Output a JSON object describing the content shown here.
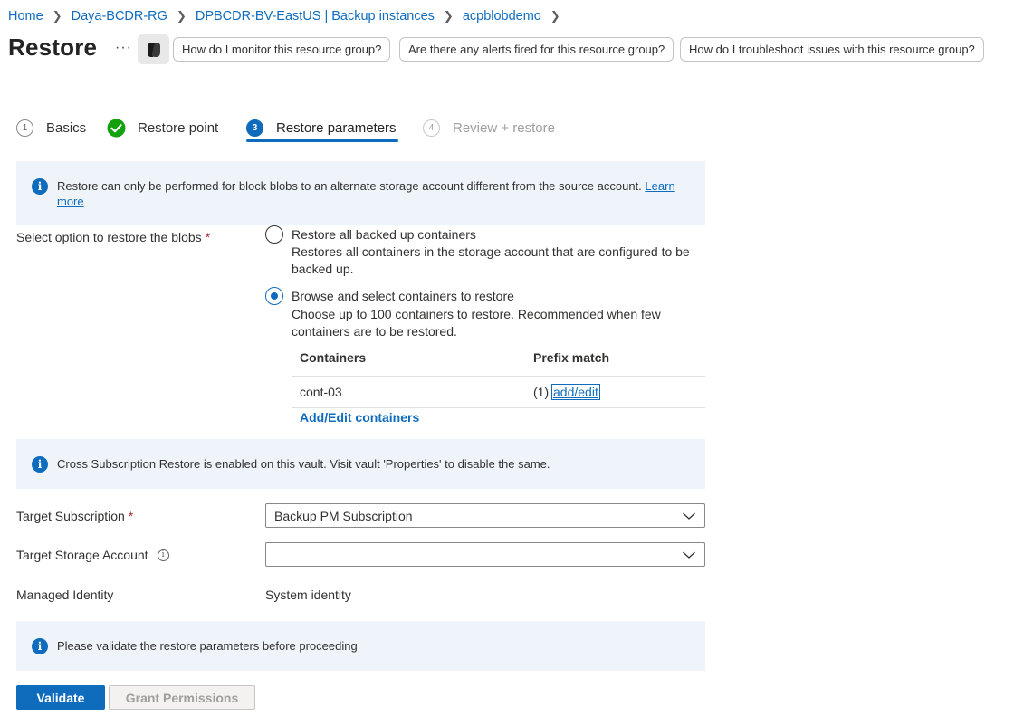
{
  "breadcrumb": {
    "items": [
      "Home",
      "Daya-BCDR-RG",
      "DPBCDR-BV-EastUS | Backup instances",
      "acpblobdemo"
    ],
    "separator": ">"
  },
  "header": {
    "title": "Restore",
    "more_label": "···",
    "suggestions": [
      "How do I monitor this resource group?",
      "Are there any alerts fired for this resource group?",
      "How do I troubleshoot issues with this resource group?"
    ]
  },
  "steps": [
    {
      "num": "1",
      "label": "Basics",
      "state": "default"
    },
    {
      "num": "✓",
      "label": "Restore point",
      "state": "complete"
    },
    {
      "num": "3",
      "label": "Restore parameters",
      "state": "active"
    },
    {
      "num": "4",
      "label": "Review + restore",
      "state": "disabled"
    }
  ],
  "banners": {
    "block_blobs": {
      "text": "Restore can only be performed for block blobs to an alternate storage account different from the source account.",
      "link_part1": "Learn",
      "link_part2": "more"
    },
    "cross_sub": {
      "text": "Cross Subscription Restore is enabled on this vault. Visit vault 'Properties' to disable the same."
    },
    "validate": {
      "text": "Please validate the restore parameters before proceeding"
    }
  },
  "restore_option": {
    "label": "Select option to restore the blobs",
    "required": "*",
    "options": [
      {
        "title": "Restore all backed up containers",
        "desc_line1": "Restores all containers in the storage account that are configured to be",
        "desc_line2": "backed up.",
        "checked": false
      },
      {
        "title": "Browse and select containers to restore",
        "desc_line1": "Choose up to 100 containers to restore. Recommended when few",
        "desc_line2": "containers are to be restored.",
        "checked": true
      }
    ]
  },
  "containers_table": {
    "headers": [
      "Containers",
      "Prefix match"
    ],
    "rows": [
      {
        "container": "cont-03",
        "prefix_count": "(1)",
        "prefix_link": "add/edit"
      }
    ],
    "add_edit_label": "Add/Edit containers"
  },
  "target_subscription": {
    "label": "Target Subscription",
    "required": "*",
    "value": "Backup PM Subscription"
  },
  "target_storage": {
    "label": "Target Storage Account",
    "value": ""
  },
  "managed_identity": {
    "label": "Managed Identity",
    "value": "System identity"
  },
  "buttons": {
    "validate": "Validate",
    "grant": "Grant Permissions"
  },
  "colors": {
    "accent": "#0f6cbd",
    "success": "#13a10e",
    "banner_bg": "#eff4fb",
    "required": "#a4262c"
  }
}
